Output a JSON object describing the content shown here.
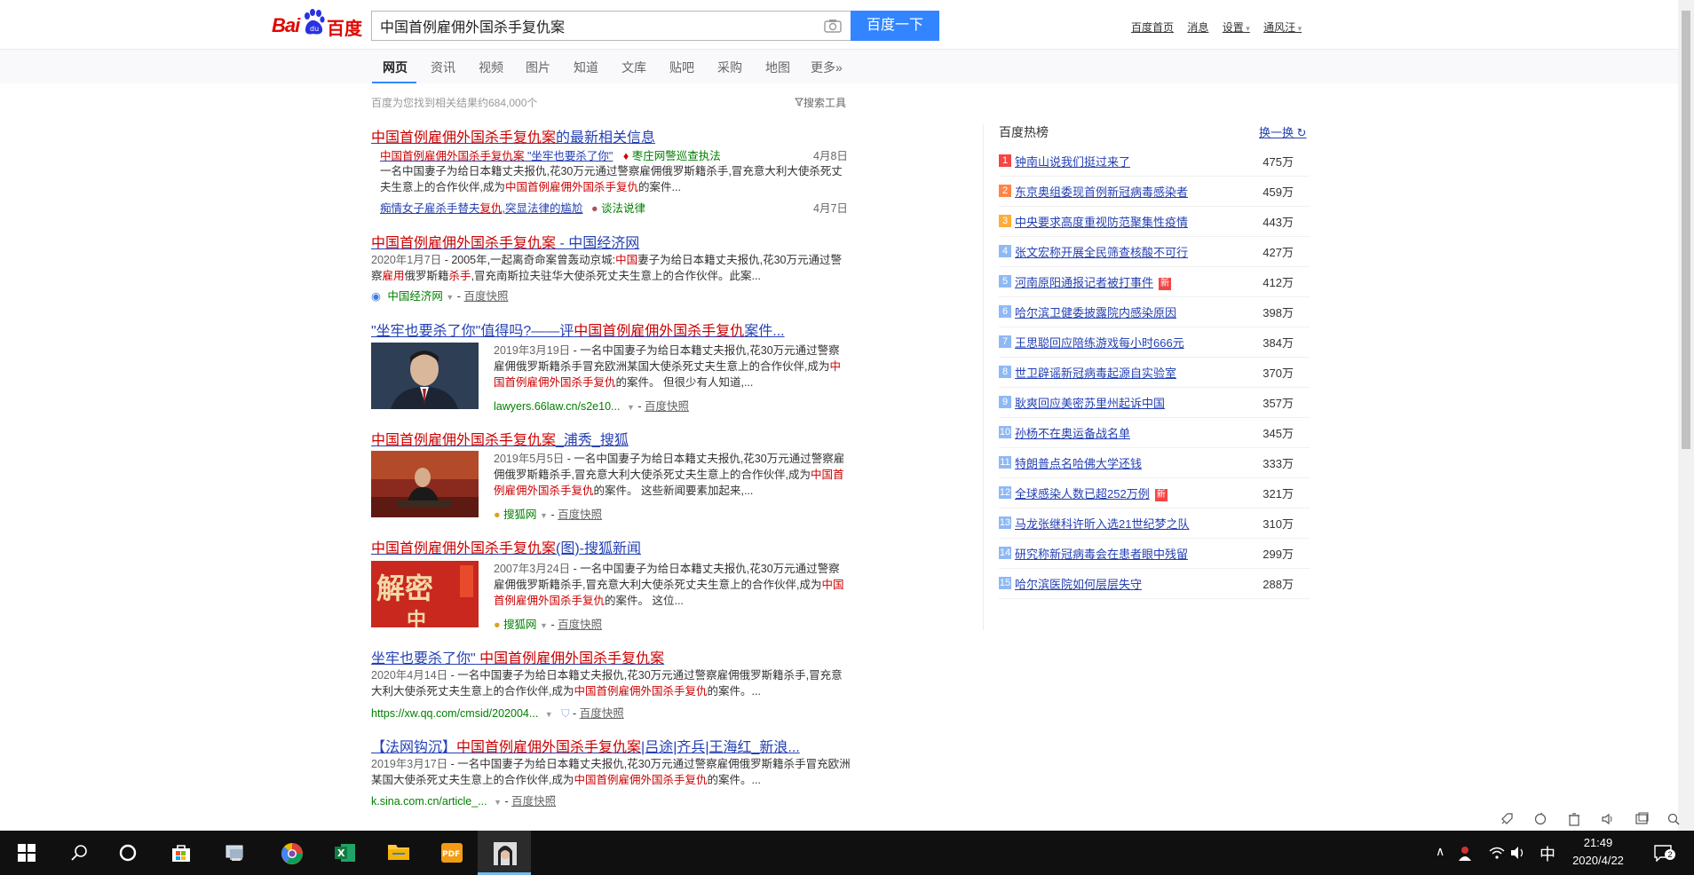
{
  "logo": {
    "bai": "Bai",
    "du": "百度"
  },
  "search": {
    "query": "中国首例雇佣外国杀手复仇案",
    "button": "百度一下"
  },
  "top_links": [
    "百度首页",
    "消息",
    "设置",
    "通风汪"
  ],
  "tabs": [
    "网页",
    "资讯",
    "视频",
    "图片",
    "知道",
    "文库",
    "贴吧",
    "采购",
    "地图",
    "更多»"
  ],
  "result_count": "百度为您找到相关结果约684,000个",
  "search_tools": "搜索工具",
  "results": [
    {
      "title_pre": "中国首例雇佣外国杀手复仇案",
      "title_post": "的最新相关信息",
      "sub": [
        {
          "link_em": "中国首例雇佣外国杀手复仇案",
          "link_rest": " \"坐牢也要杀了你\"",
          "source": "枣庄网警巡查执法",
          "date": "4月8日"
        },
        {
          "link_pre": "痴情女子雇杀手替夫",
          "link_em": "复仇",
          "link_rest": ",突显法律的尴尬",
          "source": "谈法说律",
          "date": "4月7日"
        }
      ],
      "abstract_pre": "一名中国妻子为给日本籍丈夫报仇,花30万元通过警察雇佣俄罗斯籍杀手,冒充意大利大使杀死丈夫生意上的合作伙伴,成为",
      "abstract_em": "中国首例雇佣外国杀手复仇",
      "abstract_post": "的案件..."
    },
    {
      "title_em": "中国首例雇佣外国杀手复仇案",
      "title_post": " - 中国经济网",
      "date": "2020年1月7日",
      "abstract_a": " - 2005年,一起离奇命案曾轰动京城:",
      "abstract_em1": "中国",
      "abstract_b": "妻子为给日本籍丈夫报仇,花30万元通过警察",
      "abstract_em2": "雇用",
      "abstract_c": "俄罗斯籍",
      "abstract_em3": "杀手",
      "abstract_d": ",冒充南斯拉夫驻华大使杀死丈夫生意上的合作伙伴。此案...",
      "url": "中国经济网",
      "cache": "百度快照"
    },
    {
      "title_pre": "\"坐牢也要杀了你\"值得吗?——评",
      "title_em": "中国首例雇佣外国杀手复仇",
      "title_post": "案件...",
      "date": "2019年3月19日",
      "abstract_pre": " - 一名中国妻子为给日本籍丈夫报仇,花30万元通过警察雇佣俄罗斯籍杀手冒充欧洲某国大使杀死丈夫生意上的合作伙伴,成为",
      "abstract_em": "中国首例雇佣外国杀手复仇",
      "abstract_post": "的案件。 但很少有人知道,...",
      "url": "lawyers.66law.cn/s2e10...",
      "cache": "百度快照"
    },
    {
      "title_em": "中国首例雇佣外国杀手复仇案",
      "title_post": "_浦秀_搜狐",
      "date": "2019年5月5日",
      "abstract_pre": " - 一名中国妻子为给日本籍丈夫报仇,花30万元通过警察雇佣俄罗斯籍杀手,冒充意大利大使杀死丈夫生意上的合作伙伴,成为",
      "abstract_em": "中国首例雇佣外国杀手复仇",
      "abstract_post": "的案件。 这些新闻要素加起来,...",
      "url": "搜狐网",
      "cache": "百度快照"
    },
    {
      "title_em": "中国首例雇佣外国杀手复仇案",
      "title_post": "(图)-搜狐新闻",
      "date": "2007年3月24日",
      "abstract_pre": " - 一名中国妻子为给日本籍丈夫报仇,花30万元通过警察雇佣俄罗斯籍杀手,冒充意大利大使杀死丈夫生意上的合作伙伴,成为",
      "abstract_em": "中国首例雇佣外国杀手复仇",
      "abstract_post": "的案件。 这位...",
      "url": "搜狐网",
      "cache": "百度快照",
      "thumb_text": "解密"
    },
    {
      "title_pre": "坐牢也要杀了你\" ",
      "title_em": "中国首例雇佣外国杀手复仇案",
      "title_post": "",
      "date": "2020年4月14日",
      "abstract_pre": " - 一名中国妻子为给日本籍丈夫报仇,花30万元通过警察雇佣俄罗斯籍杀手,冒充意大利大使杀死丈夫生意上的合作伙伴,成为",
      "abstract_em": "中国首例雇佣外国杀手复仇",
      "abstract_post": "的案件。...",
      "url": "https://xw.qq.com/cmsid/202004...",
      "cache": "百度快照"
    },
    {
      "title_pre": "【法网钩沉】",
      "title_em": "中国首例雇佣外国杀手复仇案",
      "title_post": "|吕途|齐兵|王海红_新浪...",
      "date": "2019年3月17日",
      "abstract_pre": " - 一名中国妻子为给日本籍丈夫报仇,花30万元通过警察雇佣俄罗斯籍杀手冒充欧洲某国大使杀死丈夫生意上的合作伙伴,成为",
      "abstract_em": "中国首例雇佣外国杀手复仇",
      "abstract_post": "的案件。...",
      "url": "k.sina.com.cn/article_...",
      "cache": "百度快照"
    }
  ],
  "hot": {
    "title": "百度热榜",
    "refresh": "换一换",
    "items": [
      {
        "num": "1",
        "text": "钟南山说我们挺过来了",
        "val": "475万",
        "color": "#f54545"
      },
      {
        "num": "2",
        "text": "东京奥组委现首例新冠病毒感染者",
        "val": "459万",
        "color": "#ff8547"
      },
      {
        "num": "3",
        "text": "中央要求高度重视防范聚集性疫情",
        "val": "443万",
        "color": "#ffac38"
      },
      {
        "num": "4",
        "text": "张文宏称开展全民筛查核酸不可行",
        "val": "427万",
        "color": "#8eb9f5"
      },
      {
        "num": "5",
        "text": "河南原阳通报记者被打事件",
        "val": "412万",
        "color": "#8eb9f5",
        "badge": "新"
      },
      {
        "num": "6",
        "text": "哈尔滨卫健委披露院内感染原因",
        "val": "398万",
        "color": "#8eb9f5"
      },
      {
        "num": "7",
        "text": "王思聪回应陪练游戏每小时666元",
        "val": "384万",
        "color": "#8eb9f5"
      },
      {
        "num": "8",
        "text": "世卫辟谣新冠病毒起源自实验室",
        "val": "370万",
        "color": "#8eb9f5"
      },
      {
        "num": "9",
        "text": "耿爽回应美密苏里州起诉中国",
        "val": "357万",
        "color": "#8eb9f5"
      },
      {
        "num": "10",
        "text": "孙杨不在奥运备战名单",
        "val": "345万",
        "color": "#8eb9f5"
      },
      {
        "num": "11",
        "text": "特朗普点名哈佛大学还钱",
        "val": "333万",
        "color": "#8eb9f5"
      },
      {
        "num": "12",
        "text": "全球感染人数已超252万例",
        "val": "321万",
        "color": "#8eb9f5",
        "badge": "新"
      },
      {
        "num": "13",
        "text": "马龙张继科许昕入选21世纪梦之队",
        "val": "310万",
        "color": "#8eb9f5"
      },
      {
        "num": "14",
        "text": "研究称新冠病毒会在患者眼中残留",
        "val": "299万",
        "color": "#8eb9f5"
      },
      {
        "num": "15",
        "text": "哈尔滨医院如何层层失守",
        "val": "288万",
        "color": "#8eb9f5"
      }
    ]
  },
  "taskbar": {
    "time": "21:49",
    "date": "2020/4/22",
    "ime": "中",
    "notify_count": "2"
  }
}
